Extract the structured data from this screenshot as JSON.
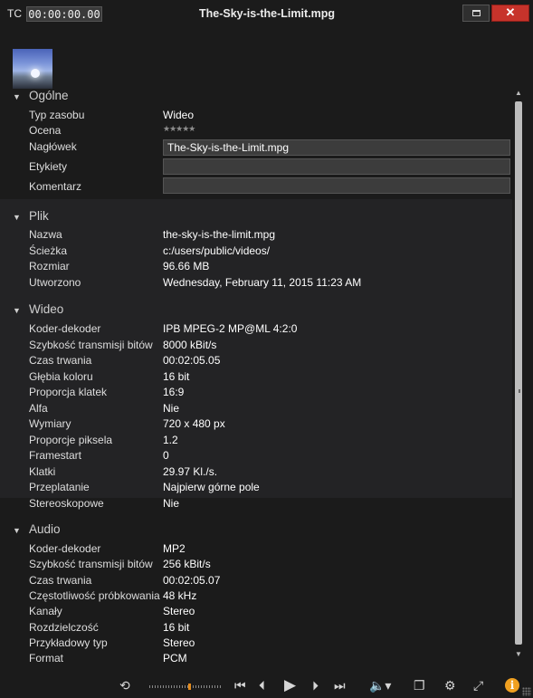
{
  "titlebar": {
    "tc_label": "TC",
    "timecode": "00:00:00.00",
    "title": "The-Sky-is-the-Limit.mpg",
    "close_glyph": "✕"
  },
  "general": {
    "heading": "Ogólne",
    "type_label": "Typ zasobu",
    "type_value": "Wideo",
    "rating_label": "Ocena",
    "rating_value": 0,
    "rating_max": 5,
    "caption_label": "Nagłówek",
    "caption_value": "The-Sky-is-the-Limit.mpg",
    "tags_label": "Etykiety",
    "tags_value": "",
    "comment_label": "Komentarz",
    "comment_value": ""
  },
  "file": {
    "heading": "Plik",
    "rows": [
      {
        "k": "Nazwa",
        "v": "the-sky-is-the-limit.mpg"
      },
      {
        "k": "Ścieżka",
        "v": "c:/users/public/videos/"
      },
      {
        "k": "Rozmiar",
        "v": "96.66 MB"
      },
      {
        "k": "Utworzono",
        "v": "Wednesday, February 11, 2015 11:23 AM"
      }
    ]
  },
  "video": {
    "heading": "Wideo",
    "rows": [
      {
        "k": "Koder-dekoder",
        "v": "IPB MPEG-2  MP@ML 4:2:0"
      },
      {
        "k": "Szybkość transmisji bitów",
        "v": "8000 kBit/s"
      },
      {
        "k": "Czas trwania",
        "v": "00:02:05.05"
      },
      {
        "k": "Głębia koloru",
        "v": "16 bit"
      },
      {
        "k": "Proporcja klatek",
        "v": "16:9"
      },
      {
        "k": "Alfa",
        "v": "Nie"
      },
      {
        "k": "Wymiary",
        "v": "720 x 480 px"
      },
      {
        "k": "Proporcje piksela",
        "v": "1.2"
      },
      {
        "k": "Framestart",
        "v": "0"
      },
      {
        "k": "Klatki",
        "v": "29.97 Kl./s."
      },
      {
        "k": "Przeplatanie",
        "v": "Najpierw górne pole"
      },
      {
        "k": "Stereoskopowe",
        "v": "Nie"
      }
    ]
  },
  "audio": {
    "heading": "Audio",
    "rows": [
      {
        "k": "Koder-dekoder",
        "v": "MP2"
      },
      {
        "k": "Szybkość transmisji bitów",
        "v": "256 kBit/s"
      },
      {
        "k": "Czas trwania",
        "v": "00:02:05.07"
      },
      {
        "k": "Częstotliwość próbkowania",
        "v": "48 kHz"
      },
      {
        "k": "Kanały",
        "v": "Stereo"
      },
      {
        "k": "Rozdzielczość",
        "v": "16 bit"
      },
      {
        "k": "Przykładowy typ",
        "v": "Stereo"
      },
      {
        "k": "Format",
        "v": "PCM"
      }
    ]
  },
  "transport": {
    "icons": [
      "loop-icon",
      "to-start-icon",
      "prev-frame-icon",
      "play-icon",
      "next-frame-icon",
      "to-end-icon",
      "volume-icon",
      "copy-icon",
      "gear-icon",
      "fullscreen-icon",
      "info-icon"
    ],
    "scrub_position": 0.55,
    "info_glyph": "i"
  },
  "colors": {
    "accent": "#e38b1d",
    "close": "#c7332b",
    "info": "#f0a020"
  }
}
